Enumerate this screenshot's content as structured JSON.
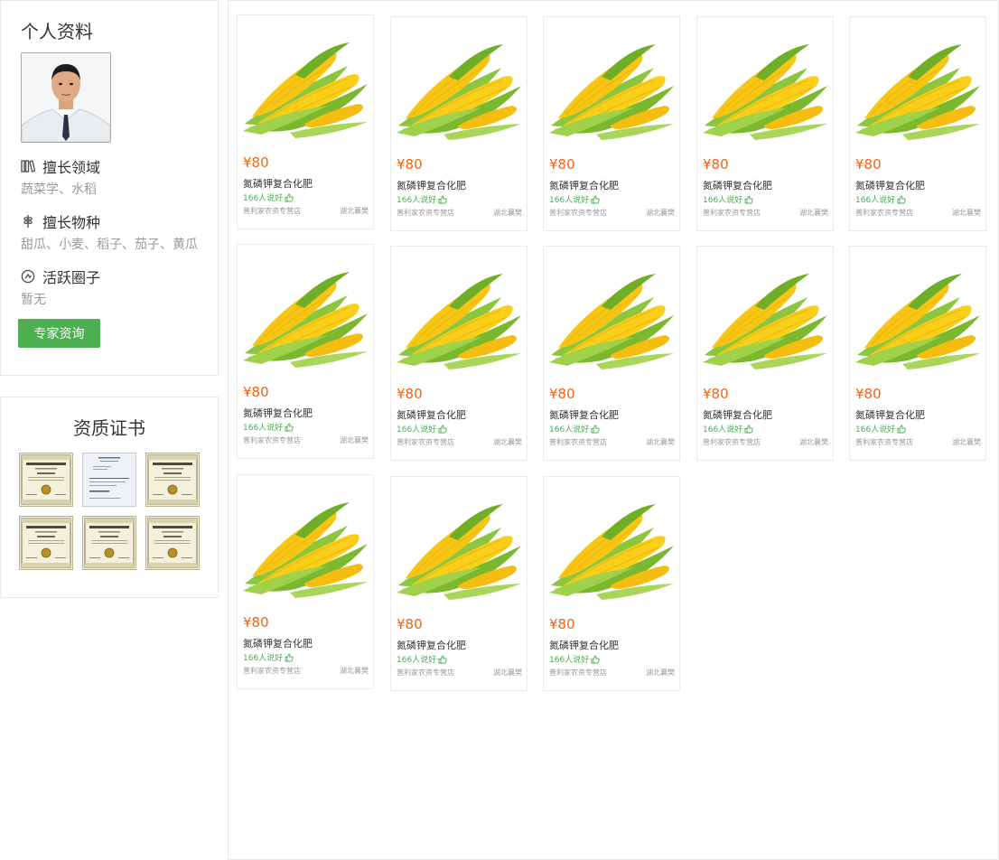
{
  "profile": {
    "title": "个人资料",
    "sections": [
      {
        "heading": "擅长领域",
        "icon": "books-icon",
        "value": "蔬菜学、水稻"
      },
      {
        "heading": "擅长物种",
        "icon": "plant-icon",
        "value": "甜瓜、小麦、稻子、茄子、黄瓜"
      },
      {
        "heading": "活跃圈子",
        "icon": "circle-link-icon",
        "value": "暂无"
      }
    ],
    "consult_button": "专家资询"
  },
  "certificates": {
    "title": "资质证书",
    "items": [
      "certificate",
      "document",
      "certificate",
      "certificate",
      "certificate",
      "certificate"
    ]
  },
  "products": [
    {
      "price": "¥80",
      "name": "氮磷钾复合化肥",
      "likes": "166人说好",
      "store": "普利家农资专营店",
      "location": "湖北襄樊"
    },
    {
      "price": "¥80",
      "name": "氮磷钾复合化肥",
      "likes": "166人说好",
      "store": "普利家农资专营店",
      "location": "湖北襄樊"
    },
    {
      "price": "¥80",
      "name": "氮磷钾复合化肥",
      "likes": "166人说好",
      "store": "普利家农资专营店",
      "location": "湖北襄樊"
    },
    {
      "price": "¥80",
      "name": "氮磷钾复合化肥",
      "likes": "166人说好",
      "store": "普利家农资专营店",
      "location": "湖北襄樊"
    },
    {
      "price": "¥80",
      "name": "氮磷钾复合化肥",
      "likes": "166人说好",
      "store": "普利家农资专营店",
      "location": "湖北襄樊"
    },
    {
      "price": "¥80",
      "name": "氮磷钾复合化肥",
      "likes": "166人说好",
      "store": "普利家农资专营店",
      "location": "湖北襄樊"
    },
    {
      "price": "¥80",
      "name": "氮磷钾复合化肥",
      "likes": "166人说好",
      "store": "普利家农资专营店",
      "location": "湖北襄樊"
    },
    {
      "price": "¥80",
      "name": "氮磷钾复合化肥",
      "likes": "166人说好",
      "store": "普利家农资专营店",
      "location": "湖北襄樊"
    },
    {
      "price": "¥80",
      "name": "氮磷钾复合化肥",
      "likes": "166人说好",
      "store": "普利家农资专营店",
      "location": "湖北襄樊"
    },
    {
      "price": "¥80",
      "name": "氮磷钾复合化肥",
      "likes": "166人说好",
      "store": "普利家农资专营店",
      "location": "湖北襄樊"
    },
    {
      "price": "¥80",
      "name": "氮磷钾复合化肥",
      "likes": "166人说好",
      "store": "普利家农资专营店",
      "location": "湖北襄樊"
    },
    {
      "price": "¥80",
      "name": "氮磷钾复合化肥",
      "likes": "166人说好",
      "store": "普利家农资专营店",
      "location": "湖北襄樊"
    },
    {
      "price": "¥80",
      "name": "氮磷钾复合化肥",
      "likes": "166人说好",
      "store": "普利家农资专营店",
      "location": "湖北襄樊"
    }
  ],
  "colors": {
    "accent": "#4caf50",
    "price": "#f2630f",
    "border": "#e8e8e8"
  }
}
